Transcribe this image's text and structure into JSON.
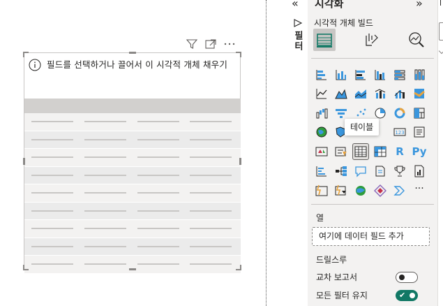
{
  "canvas": {
    "visual_notice": "필드를 선택하거나 끌어서 이 시각적 개체 채우기",
    "header_icons": [
      "filter-icon",
      "focus-mode-icon",
      "more-options-icon"
    ]
  },
  "filters_strip": {
    "collapse_glyph": "«",
    "label": "필터"
  },
  "viz_pane": {
    "title": "시각화",
    "expand_glyph": "»",
    "subtitle": "시각적 개체 빌드",
    "tabs": [
      "build-visual-tab",
      "format-visual-tab",
      "analytics-tab"
    ],
    "tooltip": "테이블",
    "text_icons": {
      "r": "R",
      "py": "Py",
      "more": "···",
      "card": "123"
    },
    "columns_label": "열",
    "well_placeholder": "여기에 데이터 필드 추가",
    "drillthrough_label": "드릴스루",
    "cross_report_label": "교차 보고서",
    "keep_filters_label": "모든 필터 유지",
    "cross_report_on": false,
    "keep_filters_on": true,
    "accent_color": "#117865",
    "icon_blue": "#3a96dd"
  }
}
